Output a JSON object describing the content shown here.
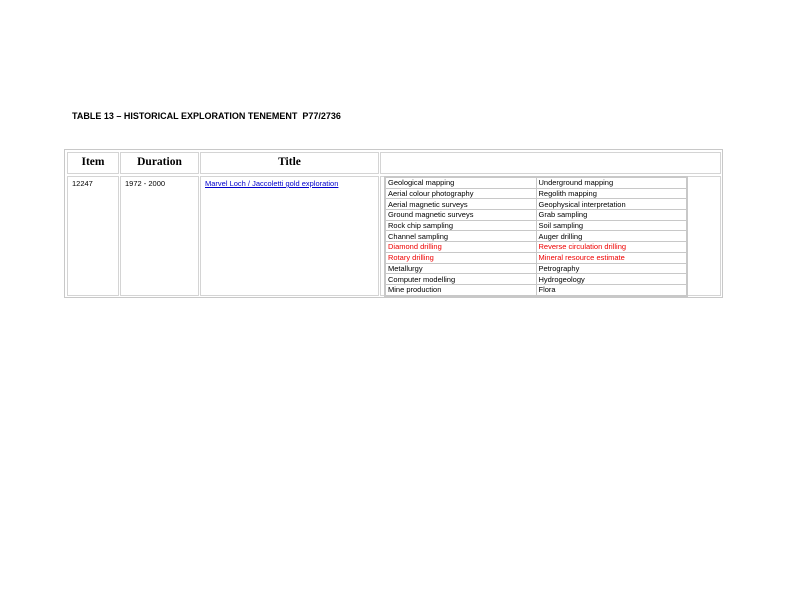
{
  "page_title": "TABLE 13 – HISTORICAL EXPLORATION TENEMENT  P77/2736",
  "table": {
    "headers": [
      "Item",
      "Duration",
      "Title",
      ""
    ],
    "row": {
      "item": "12247",
      "duration": "1972 - 2000",
      "title": "Marvel Loch / Jaccoletti gold exploration"
    },
    "activities": [
      {
        "left": "Geological mapping",
        "right": "Underground mapping",
        "highlight": false
      },
      {
        "left": "Aerial colour photography",
        "right": "Regolith mapping",
        "highlight": false
      },
      {
        "left": "Aerial magnetic surveys",
        "right": "Geophysical interpretation",
        "highlight": false
      },
      {
        "left": "Ground magnetic surveys",
        "right": "Grab sampling",
        "highlight": false
      },
      {
        "left": "Rock chip sampling",
        "right": "Soil sampling",
        "highlight": false
      },
      {
        "left": "Channel sampling",
        "right": "Auger drilling",
        "highlight": false
      },
      {
        "left": "Diamond drilling",
        "right": "Reverse circulation drilling",
        "highlight": true
      },
      {
        "left": "Rotary drilling",
        "right": "Mineral resource estimate",
        "highlight": true
      },
      {
        "left": "Metallurgy",
        "right": "Petrography",
        "highlight": false
      },
      {
        "left": "Computer modelling",
        "right": "Hydrogeology",
        "highlight": false
      },
      {
        "left": "Mine production",
        "right": "Flora",
        "highlight": false
      }
    ],
    "highlight_color": "#ee0000",
    "link_color": "#0000cc"
  }
}
